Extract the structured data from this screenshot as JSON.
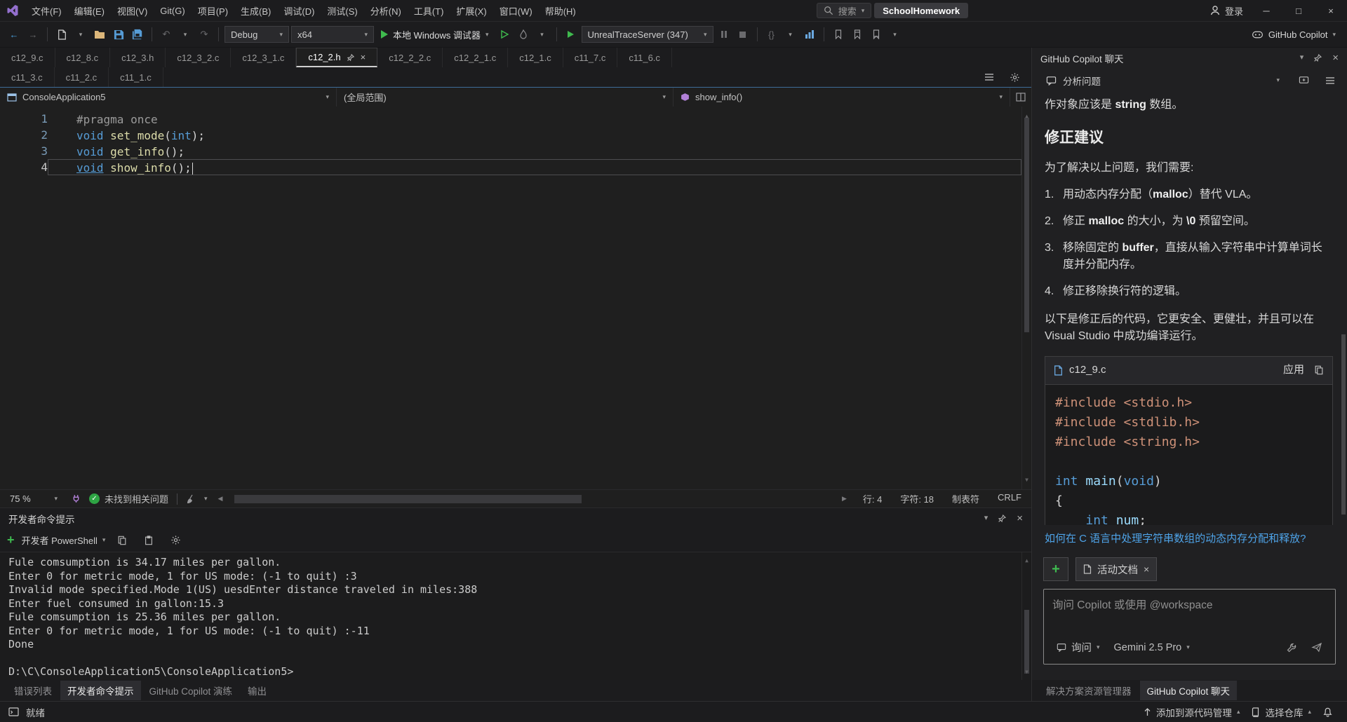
{
  "titlebar": {
    "menus": [
      "文件(F)",
      "编辑(E)",
      "视图(V)",
      "Git(G)",
      "项目(P)",
      "生成(B)",
      "调试(D)",
      "测试(S)",
      "分析(N)",
      "工具(T)",
      "扩展(X)",
      "窗口(W)",
      "帮助(H)"
    ],
    "search_label": "搜索",
    "solution_name": "SchoolHomework",
    "sign_in_label": "登录"
  },
  "toolbar": {
    "configuration": "Debug",
    "platform": "x64",
    "start_debug_label": "本地 Windows 调试器",
    "trace_server_label": "UnrealTraceServer (347)",
    "copilot_label": "GitHub Copilot"
  },
  "editor": {
    "tabs_row1": [
      {
        "label": "c12_9.c"
      },
      {
        "label": "c12_8.c"
      },
      {
        "label": "c12_3.h"
      },
      {
        "label": "c12_3_2.c"
      },
      {
        "label": "c12_3_1.c"
      },
      {
        "label": "c12_2.h",
        "active": true
      },
      {
        "label": "c12_2_2.c"
      },
      {
        "label": "c12_2_1.c"
      },
      {
        "label": "c12_1.c"
      },
      {
        "label": "c11_7.c"
      },
      {
        "label": "c11_6.c"
      }
    ],
    "tabs_row2": [
      {
        "label": "c11_3.c"
      },
      {
        "label": "c11_2.c"
      },
      {
        "label": "c11_1.c"
      }
    ],
    "navbar": {
      "project": "ConsoleApplication5",
      "scope": "(全局范围)",
      "member": "show_info()"
    },
    "code_lines": [
      {
        "n": 1,
        "tokens": [
          {
            "t": "#pragma once",
            "c": "dir"
          }
        ]
      },
      {
        "n": 2,
        "tokens": [
          {
            "t": "void",
            "c": "kw"
          },
          {
            "t": " ",
            "c": "pl"
          },
          {
            "t": "set_mode",
            "c": "fn"
          },
          {
            "t": "(",
            "c": "pl"
          },
          {
            "t": "int",
            "c": "kw"
          },
          {
            "t": ");",
            "c": "pl"
          }
        ]
      },
      {
        "n": 3,
        "tokens": [
          {
            "t": "void",
            "c": "kw"
          },
          {
            "t": " ",
            "c": "pl"
          },
          {
            "t": "get_info",
            "c": "fn"
          },
          {
            "t": "();",
            "c": "pl"
          }
        ]
      },
      {
        "n": 4,
        "current": true,
        "tokens": [
          {
            "t": "void",
            "c": "kw ul"
          },
          {
            "t": " ",
            "c": "pl"
          },
          {
            "t": "show_info",
            "c": "fn"
          },
          {
            "t": "();",
            "c": "pl"
          }
        ]
      }
    ],
    "status": {
      "zoom": "75 %",
      "health": "未找到相关问题",
      "line": "行: 4",
      "column": "字符: 18",
      "indent": "制表符",
      "eol": "CRLF"
    }
  },
  "terminal": {
    "title": "开发者命令提示",
    "shell_label": "开发者 PowerShell",
    "lines": [
      "Fule comsumption is 34.17 miles per gallon.",
      "Enter 0 for metric mode, 1 for US mode: (-1 to quit) :3",
      "Invalid mode specified.Mode 1(US) uesdEnter distance traveled in miles:388",
      "Enter fuel consumed in gallon:15.3",
      "Fule comsumption is 25.36 miles per gallon.",
      "Enter 0 for metric mode, 1 for US mode: (-1 to quit) :-11",
      "Done",
      "",
      "D:\\C\\ConsoleApplication5\\ConsoleApplication5>"
    ]
  },
  "bottom_tabs_left": [
    {
      "label": "错误列表"
    },
    {
      "label": "开发者命令提示",
      "active": true
    },
    {
      "label": "GitHub Copilot 演练"
    },
    {
      "label": "输出"
    }
  ],
  "copilot": {
    "panel_title": "GitHub Copilot 聊天",
    "thread_title": "分析问题",
    "message": {
      "intro": [
        {
          "t": "作对象应该是 "
        },
        {
          "t": "string",
          "b": true
        },
        {
          "t": " 数组。"
        }
      ],
      "heading": "修正建议",
      "lead": "为了解决以上问题，我们需要:",
      "steps": [
        [
          {
            "t": "用动态内存分配（"
          },
          {
            "t": "malloc",
            "b": true
          },
          {
            "t": "）替代 VLA。"
          }
        ],
        [
          {
            "t": "修正 "
          },
          {
            "t": "malloc",
            "b": true
          },
          {
            "t": " 的大小，为 "
          },
          {
            "t": "\\0",
            "b": true
          },
          {
            "t": " 预留空间。"
          }
        ],
        [
          {
            "t": "移除固定的 "
          },
          {
            "t": "buffer",
            "b": true
          },
          {
            "t": "，直接从输入字符串中计算单词长度并分配内存。"
          }
        ],
        [
          {
            "t": "修正移除换行符的逻辑。"
          }
        ]
      ],
      "closing": "以下是修正后的代码，它更安全、更健壮，并且可以在 Visual Studio 中成功编译运行。"
    },
    "code_card": {
      "filename": "c12_9.c",
      "apply_label": "应用",
      "lines": [
        [
          {
            "t": "#include <stdio.h>",
            "c": "inc"
          }
        ],
        [
          {
            "t": "#include <stdlib.h>",
            "c": "inc"
          }
        ],
        [
          {
            "t": "#include <string.h>",
            "c": "inc"
          }
        ],
        [],
        [
          {
            "t": "int",
            "c": "kw"
          },
          {
            "t": " ",
            "c": "pl"
          },
          {
            "t": "main",
            "c": "id"
          },
          {
            "t": "(",
            "c": "pl"
          },
          {
            "t": "void",
            "c": "kw"
          },
          {
            "t": ")",
            "c": "pl"
          }
        ],
        [
          {
            "t": "{",
            "c": "pl"
          }
        ],
        [
          {
            "t": "    ",
            "c": "pl"
          },
          {
            "t": "int",
            "c": "kw"
          },
          {
            "t": " ",
            "c": "pl"
          },
          {
            "t": "num",
            "c": "id"
          },
          {
            "t": ";",
            "c": "pl"
          }
        ]
      ]
    },
    "followup": "如何在 C 语言中处理字符串数组的动态内存分配和释放?",
    "context_chip_label": "活动文档",
    "input_placeholder": "询问 Copilot 或使用 @workspace",
    "mode_label": "询问",
    "model_label": "Gemini 2.5 Pro"
  },
  "bottom_tabs_right": [
    {
      "label": "解决方案资源管理器"
    },
    {
      "label": "GitHub Copilot 聊天",
      "active": true
    }
  ],
  "statusbar": {
    "ready": "就绪",
    "add_to_source_label": "添加到源代码管理",
    "select_repo_label": "选择仓库"
  },
  "icons": {
    "chevron_down": "▾",
    "chevron_up": "▴",
    "close": "×",
    "minimize": "─",
    "maximize": "□",
    "back_arrow": "←",
    "forward_arrow": "→",
    "undo": "↶",
    "redo": "↷",
    "scroll_up": "▲",
    "scroll_down": "▼",
    "scroll_left": "◀",
    "scroll_right": "▶",
    "check": "✓",
    "plus": "+",
    "braces": "{}"
  }
}
